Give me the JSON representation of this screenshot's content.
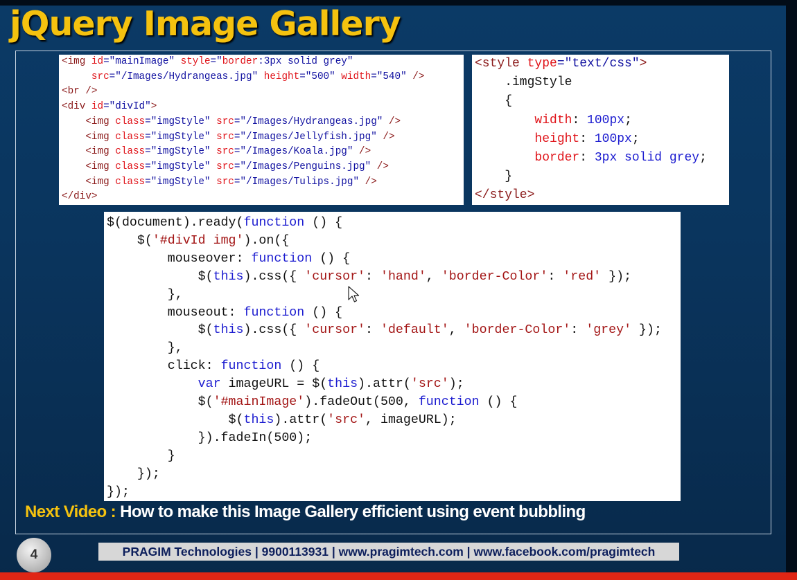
{
  "slide": {
    "title": "jQuery Image Gallery",
    "number": "4"
  },
  "html_code": [
    [
      [
        "t",
        "<img "
      ],
      [
        "a",
        "id"
      ],
      [
        "p",
        "=\"mainImage\" "
      ],
      [
        "a",
        "style"
      ],
      [
        "p",
        "=\""
      ],
      [
        "a",
        "border"
      ],
      [
        "p",
        ":3px solid grey\""
      ]
    ],
    [
      [
        "d",
        "     "
      ],
      [
        "a",
        "src"
      ],
      [
        "p",
        "=\"/Images/Hydrangeas.jpg\" "
      ],
      [
        "a",
        "height"
      ],
      [
        "p",
        "=\"500\" "
      ],
      [
        "a",
        "width"
      ],
      [
        "p",
        "=\"540\" "
      ],
      [
        "t",
        "/>"
      ]
    ],
    [
      [
        "t",
        "<br />"
      ]
    ],
    [
      [
        "t",
        "<div "
      ],
      [
        "a",
        "id"
      ],
      [
        "p",
        "=\"divId\""
      ],
      [
        "t",
        ">"
      ]
    ],
    [
      [
        "d",
        "    "
      ],
      [
        "t",
        "<img "
      ],
      [
        "a",
        "class"
      ],
      [
        "p",
        "=\"imgStyle\" "
      ],
      [
        "a",
        "src"
      ],
      [
        "p",
        "=\"/Images/Hydrangeas.jpg\" "
      ],
      [
        "t",
        "/>"
      ]
    ],
    [
      [
        "d",
        "    "
      ],
      [
        "t",
        "<img "
      ],
      [
        "a",
        "class"
      ],
      [
        "p",
        "=\"imgStyle\" "
      ],
      [
        "a",
        "src"
      ],
      [
        "p",
        "=\"/Images/Jellyfish.jpg\" "
      ],
      [
        "t",
        "/>"
      ]
    ],
    [
      [
        "d",
        "    "
      ],
      [
        "t",
        "<img "
      ],
      [
        "a",
        "class"
      ],
      [
        "p",
        "=\"imgStyle\" "
      ],
      [
        "a",
        "src"
      ],
      [
        "p",
        "=\"/Images/Koala.jpg\" "
      ],
      [
        "t",
        "/>"
      ]
    ],
    [
      [
        "d",
        "    "
      ],
      [
        "t",
        "<img "
      ],
      [
        "a",
        "class"
      ],
      [
        "p",
        "=\"imgStyle\" "
      ],
      [
        "a",
        "src"
      ],
      [
        "p",
        "=\"/Images/Penguins.jpg\" "
      ],
      [
        "t",
        "/>"
      ]
    ],
    [
      [
        "d",
        "    "
      ],
      [
        "t",
        "<img "
      ],
      [
        "a",
        "class"
      ],
      [
        "p",
        "=\"imgStyle\" "
      ],
      [
        "a",
        "src"
      ],
      [
        "p",
        "=\"/Images/Tulips.jpg\" "
      ],
      [
        "t",
        "/>"
      ]
    ],
    [
      [
        "t",
        "</div>"
      ]
    ]
  ],
  "css_code": [
    [
      [
        "t",
        "<style "
      ],
      [
        "a",
        "type"
      ],
      [
        "p",
        "=\"text/css\""
      ],
      [
        "t",
        ">"
      ]
    ],
    [
      [
        "d",
        "    .imgStyle"
      ]
    ],
    [
      [
        "d",
        "    {"
      ]
    ],
    [
      [
        "d",
        "        "
      ],
      [
        "a",
        "width"
      ],
      [
        "d",
        ": "
      ],
      [
        "v",
        "100px"
      ],
      [
        "d",
        ";"
      ]
    ],
    [
      [
        "d",
        "        "
      ],
      [
        "a",
        "height"
      ],
      [
        "d",
        ": "
      ],
      [
        "v",
        "100px"
      ],
      [
        "d",
        ";"
      ]
    ],
    [
      [
        "d",
        "        "
      ],
      [
        "a",
        "border"
      ],
      [
        "d",
        ": "
      ],
      [
        "v",
        "3px solid grey"
      ],
      [
        "d",
        ";"
      ]
    ],
    [
      [
        "d",
        "    }"
      ]
    ],
    [
      [
        "t",
        "</style>"
      ]
    ]
  ],
  "js_code": [
    [
      [
        "d",
        "$(document).ready("
      ],
      [
        "k",
        "function"
      ],
      [
        "d",
        " () {"
      ]
    ],
    [
      [
        "d",
        "    $("
      ],
      [
        "s",
        "'#divId img'"
      ],
      [
        "d",
        ").on({"
      ]
    ],
    [
      [
        "d",
        "        mouseover: "
      ],
      [
        "k",
        "function"
      ],
      [
        "d",
        " () {"
      ]
    ],
    [
      [
        "d",
        "            $("
      ],
      [
        "k",
        "this"
      ],
      [
        "d",
        ").css({ "
      ],
      [
        "s",
        "'cursor'"
      ],
      [
        "d",
        ": "
      ],
      [
        "s",
        "'hand'"
      ],
      [
        "d",
        ", "
      ],
      [
        "s",
        "'border-Color'"
      ],
      [
        "d",
        ": "
      ],
      [
        "s",
        "'red'"
      ],
      [
        "d",
        " });"
      ]
    ],
    [
      [
        "d",
        "        },"
      ]
    ],
    [
      [
        "d",
        "        mouseout: "
      ],
      [
        "k",
        "function"
      ],
      [
        "d",
        " () {"
      ]
    ],
    [
      [
        "d",
        "            $("
      ],
      [
        "k",
        "this"
      ],
      [
        "d",
        ").css({ "
      ],
      [
        "s",
        "'cursor'"
      ],
      [
        "d",
        ": "
      ],
      [
        "s",
        "'default'"
      ],
      [
        "d",
        ", "
      ],
      [
        "s",
        "'border-Color'"
      ],
      [
        "d",
        ": "
      ],
      [
        "s",
        "'grey'"
      ],
      [
        "d",
        " });"
      ]
    ],
    [
      [
        "d",
        "        },"
      ]
    ],
    [
      [
        "d",
        "        click: "
      ],
      [
        "k",
        "function"
      ],
      [
        "d",
        " () {"
      ]
    ],
    [
      [
        "d",
        "            "
      ],
      [
        "k",
        "var"
      ],
      [
        "d",
        " imageURL = $("
      ],
      [
        "k",
        "this"
      ],
      [
        "d",
        ").attr("
      ],
      [
        "s",
        "'src'"
      ],
      [
        "d",
        ");"
      ]
    ],
    [
      [
        "d",
        "            $("
      ],
      [
        "s",
        "'#mainImage'"
      ],
      [
        "d",
        ").fadeOut(500, "
      ],
      [
        "k",
        "function"
      ],
      [
        "d",
        " () {"
      ]
    ],
    [
      [
        "d",
        "                $("
      ],
      [
        "k",
        "this"
      ],
      [
        "d",
        ").attr("
      ],
      [
        "s",
        "'src'"
      ],
      [
        "d",
        ", imageURL);"
      ]
    ],
    [
      [
        "d",
        "            }).fadeIn(500);"
      ]
    ],
    [
      [
        "d",
        "        }"
      ]
    ],
    [
      [
        "d",
        "    });"
      ]
    ],
    [
      [
        "d",
        "});"
      ]
    ]
  ],
  "next_video": {
    "label": "Next Video :",
    "text": " How to make this Image Gallery efficient using event bubbling"
  },
  "footer": {
    "credit": "PRAGIM Technologies | 9900113931 | www.pragimtech.com | www.facebook.com/pragimtech"
  },
  "colors": {
    "title": "#f5c20f",
    "background": "#0b3a66",
    "accent_strip": "#e02615"
  },
  "icons": {
    "cursor": "mouse-pointer-icon"
  }
}
